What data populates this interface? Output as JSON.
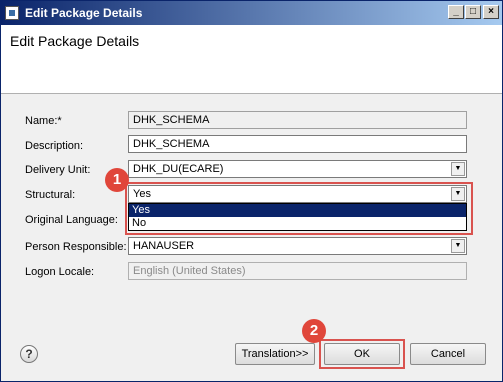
{
  "window": {
    "title": "Edit Package Details"
  },
  "header": {
    "title": "Edit Package Details"
  },
  "form": {
    "name": {
      "label": "Name:*",
      "value": "DHK_SCHEMA"
    },
    "description": {
      "label": "Description:",
      "value": "DHK_SCHEMA"
    },
    "delivery_unit": {
      "label": "Delivery Unit:",
      "value": "DHK_DU(ECARE)"
    },
    "structural": {
      "label": "Structural:",
      "value": "Yes",
      "options": [
        "Yes",
        "No"
      ]
    },
    "original_language": {
      "label": "Original Language:"
    },
    "person_responsible": {
      "label": "Person Responsible:",
      "value": "HANAUSER"
    },
    "logon_locale": {
      "label": "Logon Locale:",
      "value": "English (United States)"
    }
  },
  "annotations": {
    "step1": "1",
    "step2": "2",
    "highlight_color": "#d9534f"
  },
  "buttons": {
    "translation": "Translation>>",
    "ok": "OK",
    "cancel": "Cancel",
    "help": "?"
  },
  "icons": {
    "minimize": "minimize-icon",
    "maximize": "maximize-icon",
    "close": "close-icon",
    "help": "help-icon",
    "dropdown": "chevron-down-icon"
  }
}
